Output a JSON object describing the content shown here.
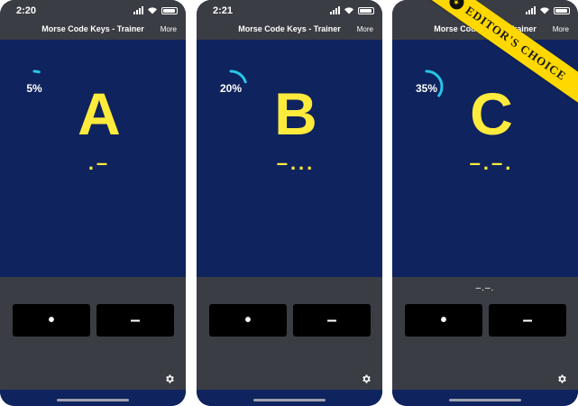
{
  "colors": {
    "accent": "#27c6e6",
    "letter": "#ffeb3b",
    "main_bg": "#0f235e",
    "panel_bg": "#3a3d43"
  },
  "app": {
    "title": "Morse Code Keys - Trainer",
    "more_label": "More"
  },
  "screens": [
    {
      "time": "2:20",
      "progress_label": "5%",
      "progress": 0.05,
      "letter": "A",
      "code": ".–",
      "typed": "",
      "dot_label": "•",
      "dash_label": "–"
    },
    {
      "time": "2:21",
      "progress_label": "20%",
      "progress": 0.2,
      "letter": "B",
      "code": "–...",
      "typed": "",
      "dot_label": "•",
      "dash_label": "–"
    },
    {
      "time": "",
      "progress_label": "35%",
      "progress": 0.35,
      "letter": "C",
      "code": "–.–.",
      "typed": "–.–.",
      "dot_label": "•",
      "dash_label": "–"
    }
  ],
  "ribbon": {
    "text": "EDITOR'S CHOICE"
  }
}
